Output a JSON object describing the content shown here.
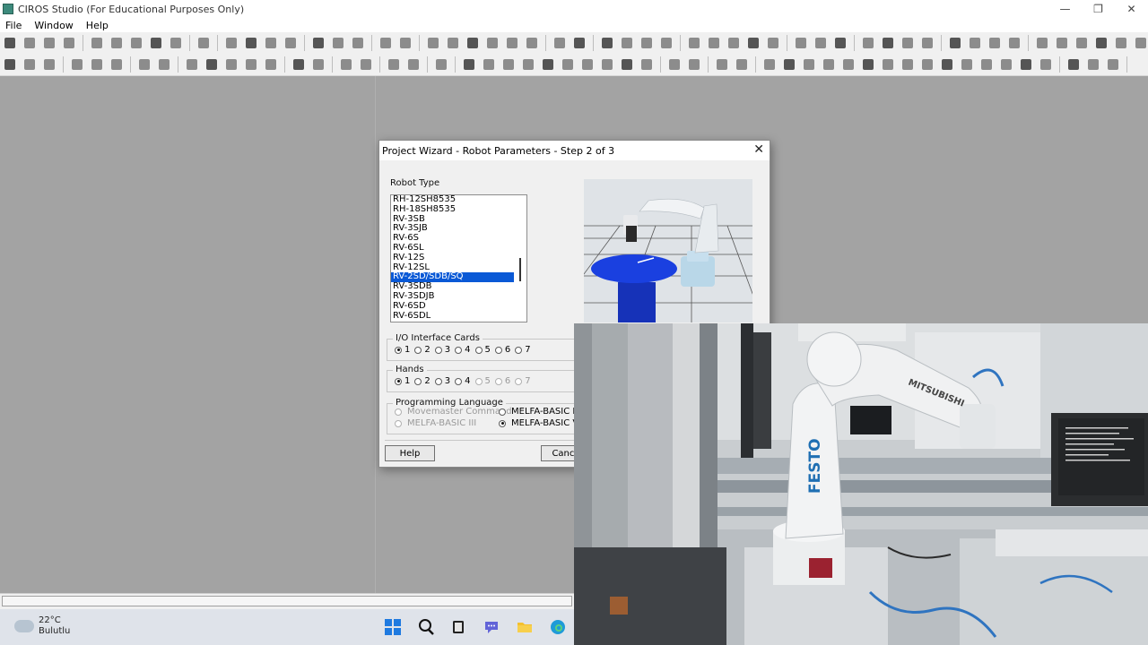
{
  "window": {
    "title": "CIROS Studio (For Educational Purposes Only)",
    "min_glyph": "—",
    "max_glyph": "❐",
    "close_glyph": "✕"
  },
  "menu": [
    "File",
    "Window",
    "Help"
  ],
  "dialog": {
    "title": "Project Wizard - Robot Parameters - Step 2 of 3",
    "close_glyph": "✕",
    "robot_type_label": "Robot Type",
    "robot_types": [
      "RH-12SH8535",
      "RH-18SH8535",
      "RV-3SB",
      "RV-3SJB",
      "RV-6S",
      "RV-6SL",
      "RV-12S",
      "RV-12SL",
      "RV-2SD/SDB/SQ",
      "RV-3SDB",
      "RV-3SDJB",
      "RV-6SD",
      "RV-6SDL"
    ],
    "selected_robot_type": "RV-2SD/SDB/SQ",
    "io_cards": {
      "label": "I/O Interface Cards",
      "options": [
        "1",
        "2",
        "3",
        "4",
        "5",
        "6",
        "7"
      ],
      "selected": "1"
    },
    "hands": {
      "label": "Hands",
      "options": [
        "1",
        "2",
        "3",
        "4",
        "5",
        "6",
        "7"
      ],
      "selected": "1"
    },
    "language": {
      "label": "Programming Language",
      "options": [
        "Movemaster Command",
        "MELFA-BASIC III",
        "MELFA-BASIC IV",
        "MELFA-BASIC V"
      ],
      "selected": "MELFA-BASIC V"
    },
    "help_button": "Help",
    "cancel_button": "Cance"
  },
  "taskbar": {
    "temperature": "22°C",
    "condition": "Bulutlu"
  },
  "camera": {
    "robot_brand_text": "FESTO",
    "arm_brand_text": "MITSUBISHI"
  },
  "colors": {
    "selection": "#0a59d6",
    "workspace": "#a3a3a3",
    "festo_blue": "#1f6fb3"
  }
}
